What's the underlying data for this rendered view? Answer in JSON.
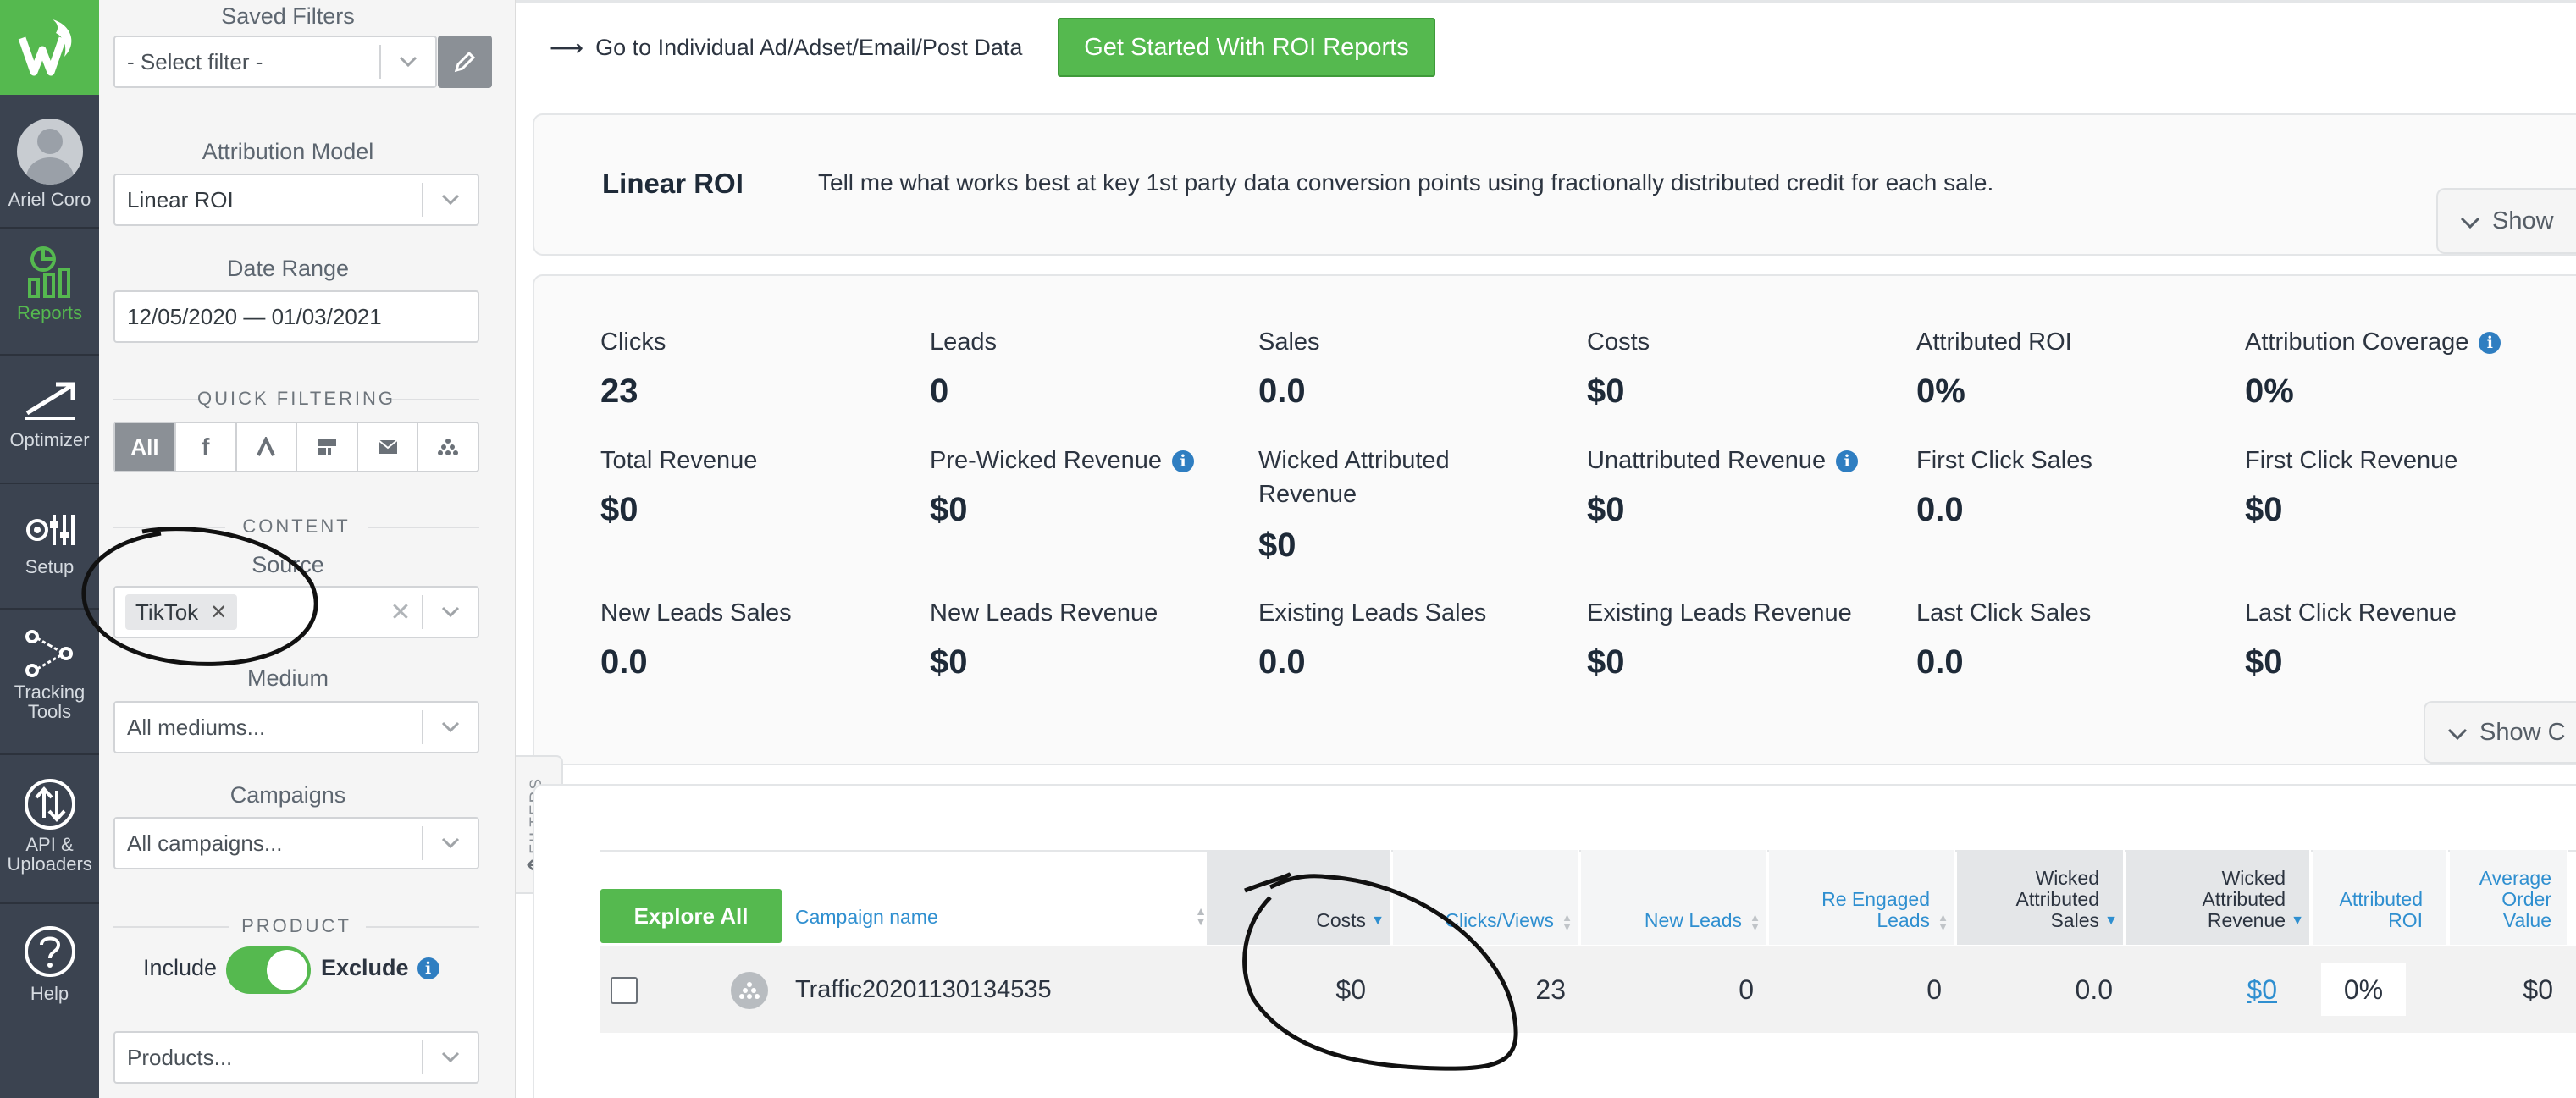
{
  "rail": {
    "user_name": "Ariel Coro",
    "items": [
      {
        "label": "Reports",
        "icon": "reports-icon"
      },
      {
        "label": "Optimizer",
        "icon": "optimizer-icon"
      },
      {
        "label": "Setup",
        "icon": "setup-icon"
      },
      {
        "label": "Tracking Tools",
        "icon": "tracking-tools-icon"
      },
      {
        "label": "API & Uploaders",
        "icon": "api-uploaders-icon"
      },
      {
        "label": "Help",
        "icon": "help-icon"
      }
    ]
  },
  "filters": {
    "saved_filters_label": "Saved Filters",
    "saved_filters_placeholder": "- Select filter -",
    "attribution_model_label": "Attribution Model",
    "attribution_model_value": "Linear ROI",
    "date_range_label": "Date Range",
    "date_range_value": "12/05/2020 — 01/03/2021",
    "quick_filtering_title": "QUICK FILTERING",
    "quick_filter_all": "All",
    "content_title": "CONTENT",
    "source_label": "Source",
    "source_tag": "TikTok",
    "medium_label": "Medium",
    "medium_placeholder": "All mediums...",
    "campaigns_label": "Campaigns",
    "campaigns_placeholder": "All campaigns...",
    "product_title": "PRODUCT",
    "include_label": "Include",
    "exclude_label": "Exclude",
    "products_placeholder": "Products...",
    "toggle_tab_label": "FILTERS"
  },
  "topbar": {
    "individual_link": "Go to Individual Ad/Adset/Email/Post Data",
    "roi_button": "Get Started With ROI Reports"
  },
  "model_card": {
    "title": "Linear ROI",
    "description": "Tell me what works best at key 1st party data conversion points using fractionally distributed credit for each sale.",
    "show_label": "Show"
  },
  "metrics": [
    {
      "label": "Clicks",
      "value": "23"
    },
    {
      "label": "Leads",
      "value": "0"
    },
    {
      "label": "Sales",
      "value": "0.0"
    },
    {
      "label": "Costs",
      "value": "$0"
    },
    {
      "label": "Attributed ROI",
      "value": "0%"
    },
    {
      "label": "Attribution Coverage",
      "value": "0%"
    },
    {
      "label": "Total Revenue",
      "value": "$0"
    },
    {
      "label": "Pre-Wicked Revenue",
      "value": "$0"
    },
    {
      "label": "Wicked Attributed",
      "label2": "Revenue",
      "value": "$0"
    },
    {
      "label": "Unattributed Revenue",
      "value": "$0"
    },
    {
      "label": "First Click Sales",
      "value": "0.0"
    },
    {
      "label": "First Click Revenue",
      "value": "$0"
    },
    {
      "label": "New Leads Sales",
      "value": "0.0"
    },
    {
      "label": "New Leads Revenue",
      "value": "$0"
    },
    {
      "label": "Existing Leads Sales",
      "value": "0.0"
    },
    {
      "label": "Existing Leads Revenue",
      "value": "$0"
    },
    {
      "label": "Last Click Sales",
      "value": "0.0"
    },
    {
      "label": "Last Click Revenue",
      "value": "$0"
    }
  ],
  "metrics_show_label": "Show C",
  "table": {
    "explore_all": "Explore All",
    "headers": {
      "campaign": "Campaign name",
      "costs": "Costs",
      "clicks": "Clicks/Views",
      "new_leads": "New Leads",
      "re_engaged_1": "Re Engaged",
      "re_engaged_2": "Leads",
      "w_sales_1": "Wicked",
      "w_sales_2": "Attributed",
      "w_sales_3": "Sales",
      "w_rev_1": "Wicked",
      "w_rev_2": "Attributed",
      "w_rev_3": "Revenue",
      "roi_1": "Attributed",
      "roi_2": "ROI",
      "aov_1": "Average",
      "aov_2": "Order",
      "aov_3": "Value"
    },
    "rows": [
      {
        "campaign": "Traffic20201130134535",
        "costs": "$0",
        "clicks": "23",
        "new_leads": "0",
        "re_engaged": "0",
        "w_sales": "0.0",
        "w_revenue": "$0",
        "roi": "0%",
        "aov": "$0"
      }
    ]
  },
  "colors": {
    "brand_green": "#55b94f",
    "rail_bg": "#3b4350",
    "link_blue": "#2f8fd0",
    "info_blue": "#2f7ec1"
  }
}
